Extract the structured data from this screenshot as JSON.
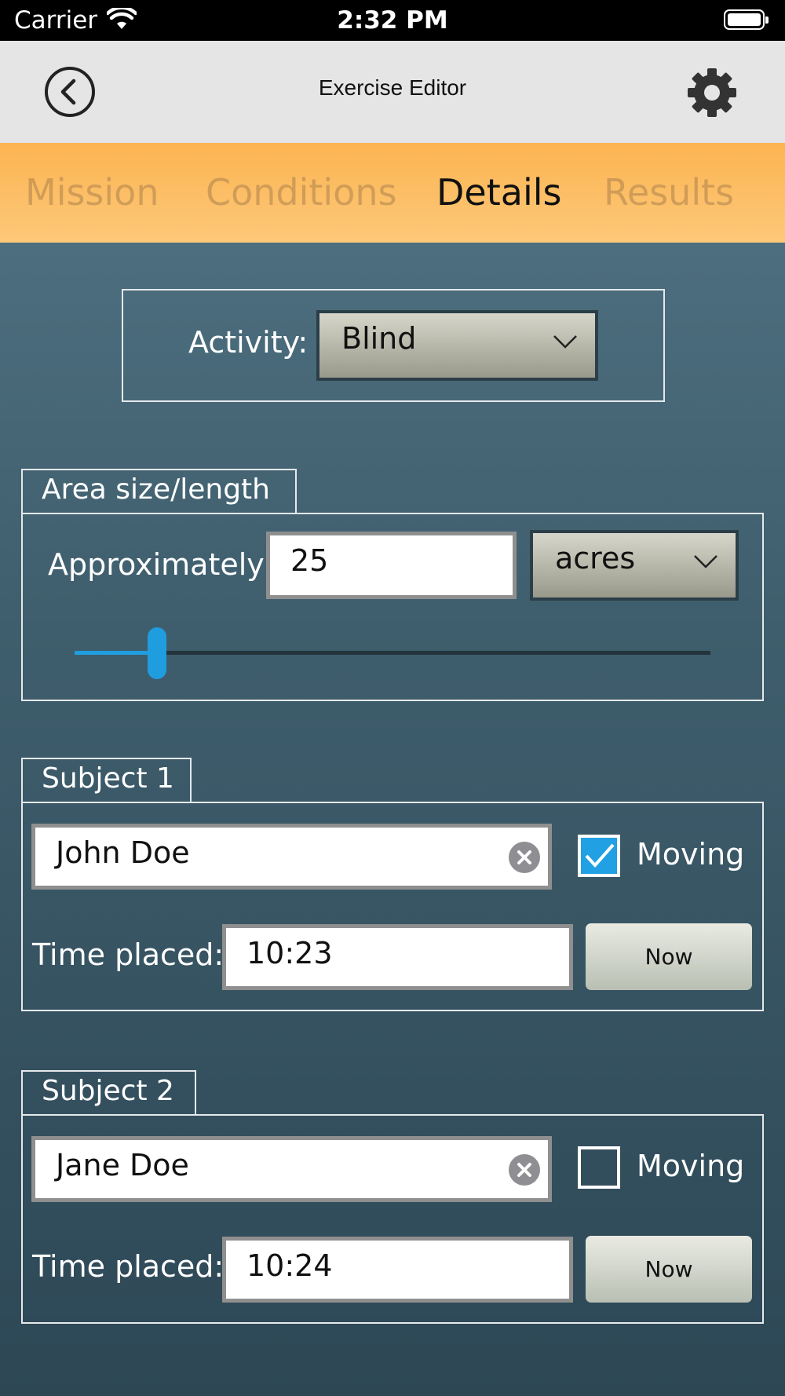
{
  "status_bar": {
    "carrier": "Carrier",
    "time": "2:32 PM"
  },
  "header": {
    "title": "Exercise Editor"
  },
  "tabs": [
    {
      "label": "Mission",
      "active": false
    },
    {
      "label": "Conditions",
      "active": false
    },
    {
      "label": "Details",
      "active": true
    },
    {
      "label": "Results",
      "active": false
    }
  ],
  "activity": {
    "label": "Activity:",
    "value": "Blind"
  },
  "area": {
    "legend": "Area size/length",
    "approx_label": "Approximately",
    "value": "25",
    "unit": "acres",
    "slider_fraction": 0.13
  },
  "subjects": [
    {
      "legend": "Subject 1",
      "name": "John Doe",
      "moving_label": "Moving",
      "moving": true,
      "time_label": "Time placed:",
      "time": "10:23",
      "now_label": "Now"
    },
    {
      "legend": "Subject 2",
      "name": "Jane Doe",
      "moving_label": "Moving",
      "moving": false,
      "time_label": "Time placed:",
      "time": "10:24",
      "now_label": "Now"
    }
  ],
  "colors": {
    "tab_bar": "#fdbd62",
    "accent": "#22a0e4",
    "background": "#476878"
  }
}
